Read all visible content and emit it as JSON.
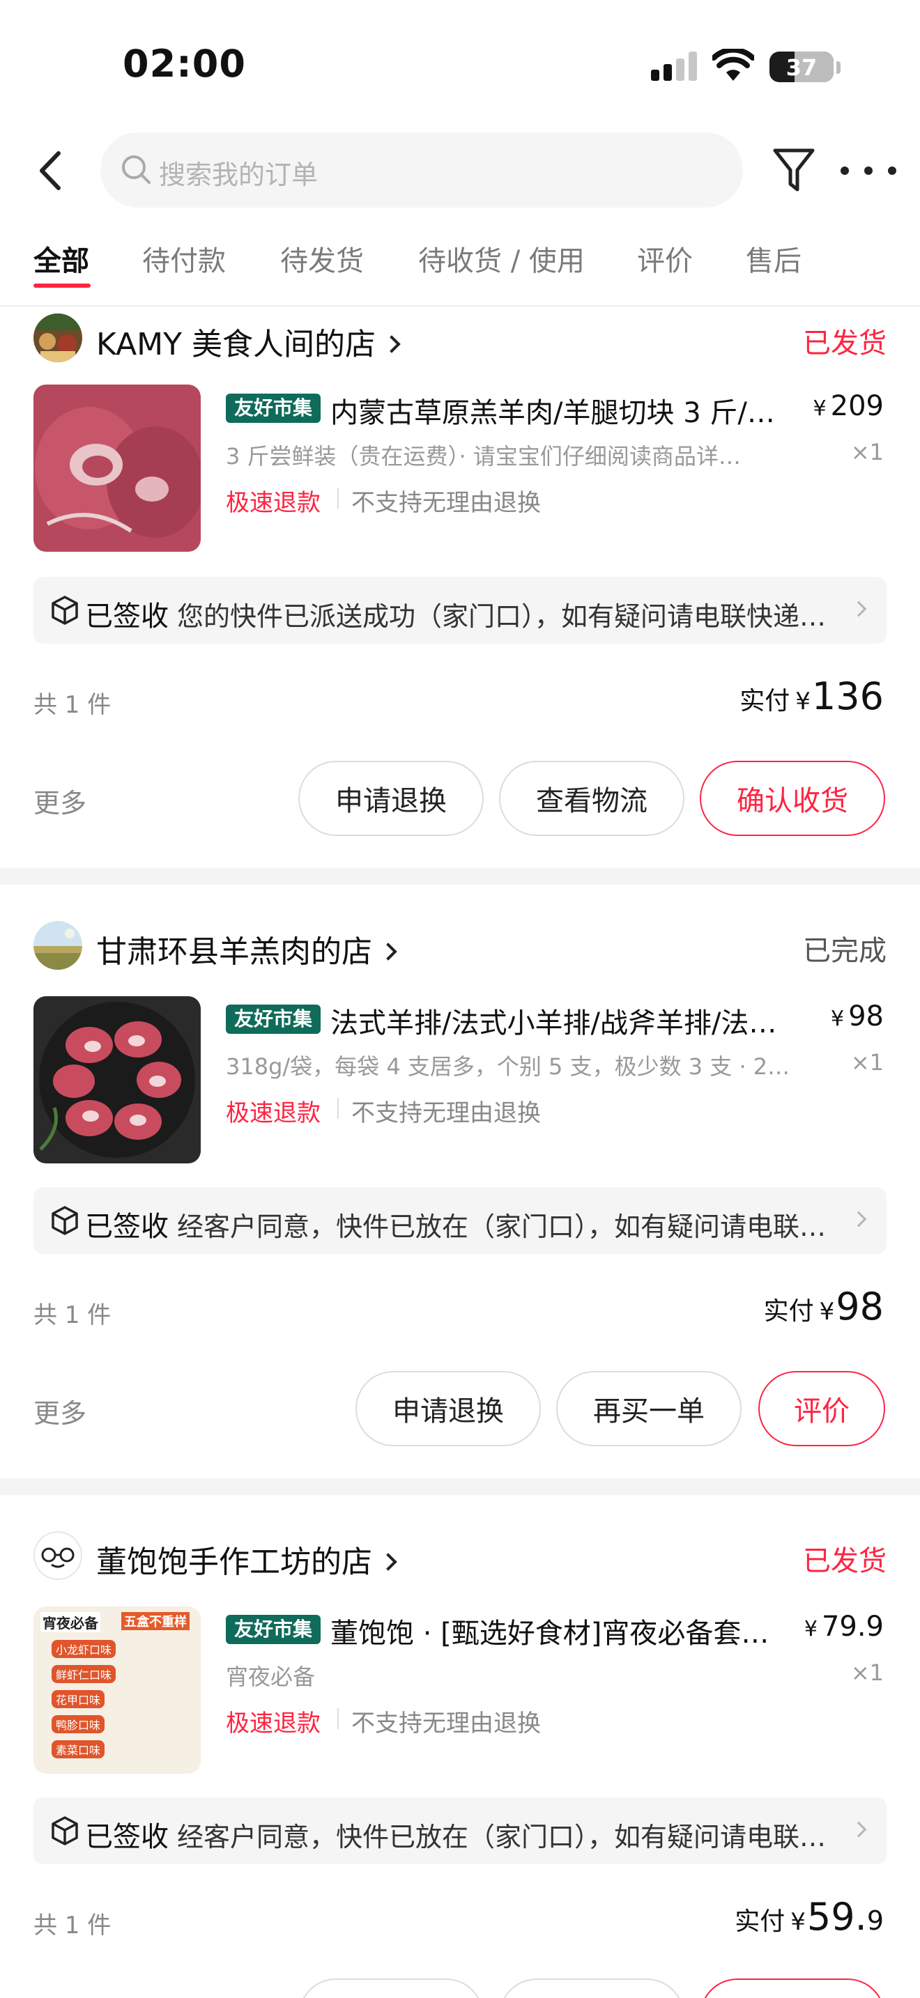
{
  "status_bar": {
    "time": "02:00",
    "battery": "37"
  },
  "nav": {
    "search_placeholder": "搜索我的订单"
  },
  "tabs": [
    {
      "label": "全部"
    },
    {
      "label": "待付款"
    },
    {
      "label": "待发货"
    },
    {
      "label": "待收货 / 使用"
    },
    {
      "label": "评价"
    },
    {
      "label": "售后"
    }
  ],
  "orders": [
    {
      "shop_name": "KAMY 美食人间的店",
      "status": "已发货",
      "status_color": "#ff2442",
      "tag": "友好市集",
      "title": "内蒙古草原羔羊肉/羊腿切块 3 斤/…",
      "price_currency": "¥",
      "price": "209",
      "spec": "3 斤尝鲜装（贵在运费）· 请宝宝们仔细阅读商品详…",
      "qty": "×1",
      "refund": "极速退款",
      "policy": "不支持无理由退换",
      "logistics_status": "已签收",
      "logistics_msg": "您的快件已派送成功（家门口），如有疑问请电联快递…",
      "item_count": "共 1 件",
      "paid_label": "实付",
      "paid_currency": "¥",
      "paid_amount": "136",
      "more": "更多",
      "actions": [
        "申请退换",
        "查看物流",
        "确认收货"
      ]
    },
    {
      "shop_name": "甘肃环县羊羔肉的店",
      "status": "已完成",
      "status_color": "#555555",
      "tag": "友好市集",
      "title": "法式羊排/法式小羊排/战斧羊排/法…",
      "price_currency": "¥",
      "price": "98",
      "spec": "318g/袋，每袋 4 支居多，个别 5 支，极少数 3 支 · 2…",
      "qty": "×1",
      "refund": "极速退款",
      "policy": "不支持无理由退换",
      "logistics_status": "已签收",
      "logistics_msg": "经客户同意，快件已放在（家门口），如有疑问请电联…",
      "item_count": "共 1 件",
      "paid_label": "实付",
      "paid_currency": "¥",
      "paid_amount": "98",
      "more": "更多",
      "actions": [
        "申请退换",
        "再买一单",
        "评价"
      ]
    },
    {
      "shop_name": "董饱饱手作工坊的店",
      "status": "已发货",
      "status_color": "#ff2442",
      "tag": "友好市集",
      "title": "董饱饱 · [甄选好食材]宵夜必备套…",
      "price_currency": "¥",
      "price": "79.9",
      "spec": "宵夜必备",
      "qty": "×1",
      "refund": "极速退款",
      "policy": "不支持无理由退换",
      "logistics_status": "已签收",
      "logistics_msg": "经客户同意，快件已放在（家门口），如有疑问请电联…",
      "item_count": "共 1 件",
      "paid_label": "实付",
      "paid_currency": "¥",
      "paid_amount_main": "59.",
      "paid_amount_tail": "9",
      "thumb_text": {
        "title_left": "宵夜必备",
        "title_right": "五盒不重样",
        "lines": [
          "小龙虾口味",
          "鲜虾仁口味",
          "花甲口味",
          "鸭胗口味",
          "素菜口味"
        ]
      }
    }
  ]
}
